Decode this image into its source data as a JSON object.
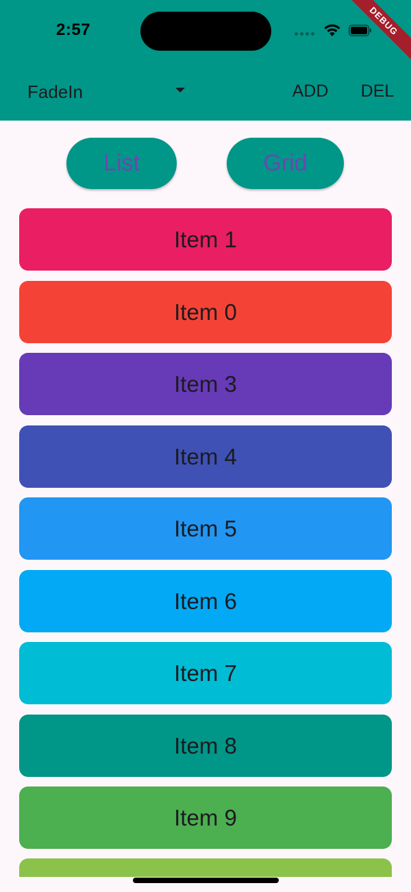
{
  "status_bar": {
    "time": "2:57"
  },
  "debug_banner": "DEBUG",
  "app_bar": {
    "animation_dropdown": {
      "selected": "FadeIn"
    },
    "add_label": "ADD",
    "del_label": "DEL",
    "background_color": "#009688"
  },
  "view_toggle": {
    "list_label": "List",
    "grid_label": "Grid",
    "button_color": "#009688",
    "text_color": "#6e46b0"
  },
  "items": [
    {
      "label": "Item 1",
      "color": "#e91e63"
    },
    {
      "label": "Item 0",
      "color": "#f44336"
    },
    {
      "label": "Item 3",
      "color": "#673ab7"
    },
    {
      "label": "Item 4",
      "color": "#3f51b5"
    },
    {
      "label": "Item 5",
      "color": "#2196f3"
    },
    {
      "label": "Item 6",
      "color": "#03a9f4"
    },
    {
      "label": "Item 7",
      "color": "#00bcd4"
    },
    {
      "label": "Item 8",
      "color": "#009688"
    },
    {
      "label": "Item 9",
      "color": "#4caf50"
    },
    {
      "label": "",
      "color": "#8bc34a"
    }
  ]
}
